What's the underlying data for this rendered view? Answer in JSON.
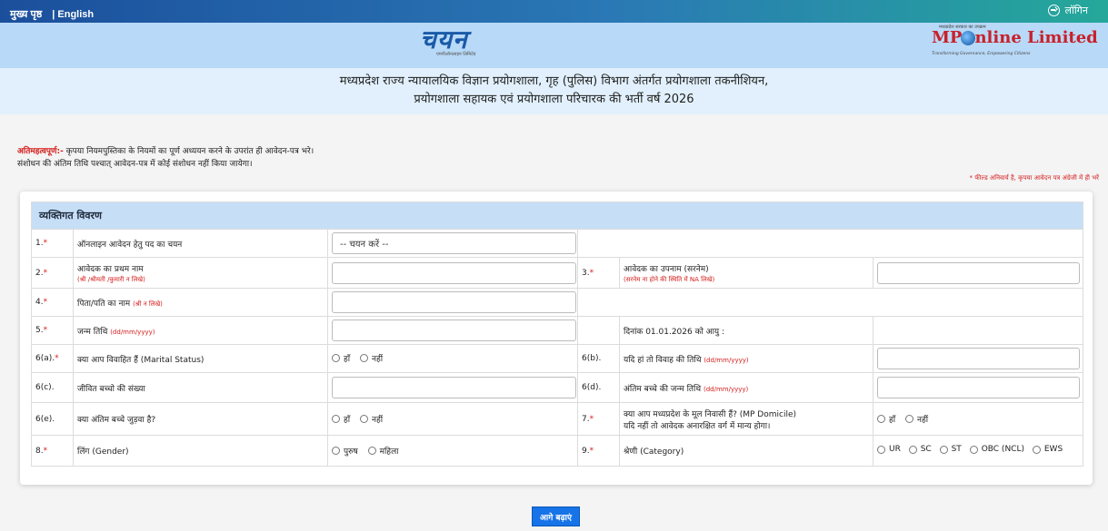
{
  "topbar": {
    "home": "मुख्य पृष्ठ",
    "english": "| English",
    "login": "लॉगिन"
  },
  "branding": {
    "chayan_mark": "चयन",
    "chayan_sub": "एमपीऑनलाइन लिमिटेड",
    "mpo_tag": "मध्यप्रदेश सरकार का उपक्रम",
    "mpo_name_left": "MP",
    "mpo_name_right": "nline Limited",
    "mpo_sub": "Transforming Governance, Empowering Citizens"
  },
  "title": {
    "line1": "मध्यप्रदेश राज्य न्यायालयिक विज्ञान प्रयोगशाला, गृह (पुलिस) विभाग अंतर्गत प्रयोगशाला तकनीशियन,",
    "line2": "प्रयोगशाला सहायक एवं प्रयोगशाला परिचारक की भर्ती वर्ष 2026"
  },
  "notice": {
    "important": "अतिमहत्वपूर्ण:-",
    "line1": " कृपया नियमपुस्तिका के नियमों का पूर्ण अध्ययन करने के उपरांत ही आवेदन-पत्र भरे।",
    "line2": "संशोधन की अंतिम तिथि पश्चात् आवेदन-पत्र में कोई संशोधन नहीं किया जायेगा।",
    "mandatory": "* फील्ड अनिवार्य है, कृपया आवेदन पत्र अंग्रेजी में ही भरें"
  },
  "form": {
    "section_title": "व्यक्तिगत विवरण",
    "select_placeholder": "-- चयन करें --",
    "rows": {
      "r1_num": "1.",
      "r1_label": "ऑनलाइन आवेदन हेतु पद का चयन",
      "r2_num": "2.",
      "r2_label": "आवेदक का प्रथम नाम",
      "r2_hint": "(श्री /श्रीमती /कुमारी न लिखे)",
      "r3_num": "3.",
      "r3_label": "आवेदक का उपनाम (सरनेम)",
      "r3_hint": "(सरनेम ना होने की स्थिति में NA लिखे)",
      "r4_num": "4.",
      "r4_label": "पिता/पति का नाम",
      "r4_hint": "(श्री न लिखे)",
      "r5_num": "5.",
      "r5_label": "जन्म तिथि",
      "r5_hint": "(dd/mm/yyyy)",
      "r5_age": "दिनांक 01.01.2026 को आयु :",
      "r6a_num": "6(a).",
      "r6a_label": "क्या आप विवाहित हैं (Marital Status)",
      "r6b_num": "6(b).",
      "r6b_label": "यदि हां तो विवाह की तिथि",
      "r6b_hint": "(dd/mm/yyyy)",
      "r6c_num": "6(c).",
      "r6c_label": "जीवित बच्चो की संख्या",
      "r6d_num": "6(d).",
      "r6d_label": "अंतिम बच्चे की जन्म तिथि",
      "r6d_hint": "(dd/mm/yyyy)",
      "r6e_num": "6(e).",
      "r6e_label": "क्या अंतिम बच्चे जुड़वा है?",
      "r7_num": "7.",
      "r7_label": "क्या आप मध्यप्रदेश के मूल निवासी हैं? (MP Domicile)",
      "r7_label2": "यदि नहीं तो आवेदक अनारक्षित वर्ग में मान्य होगा।",
      "r8_num": "8.",
      "r8_label": "लिंग (Gender)",
      "r9_num": "9.",
      "r9_label": "श्रेणी (Category)"
    },
    "yes": "हाँ",
    "no": "नहीं",
    "male": "पुरुष",
    "female": "महिला",
    "categories": [
      "UR",
      "SC",
      "ST",
      "OBC (NCL)",
      "EWS"
    ]
  },
  "button": {
    "next": "आगे बढ़ाएं"
  }
}
